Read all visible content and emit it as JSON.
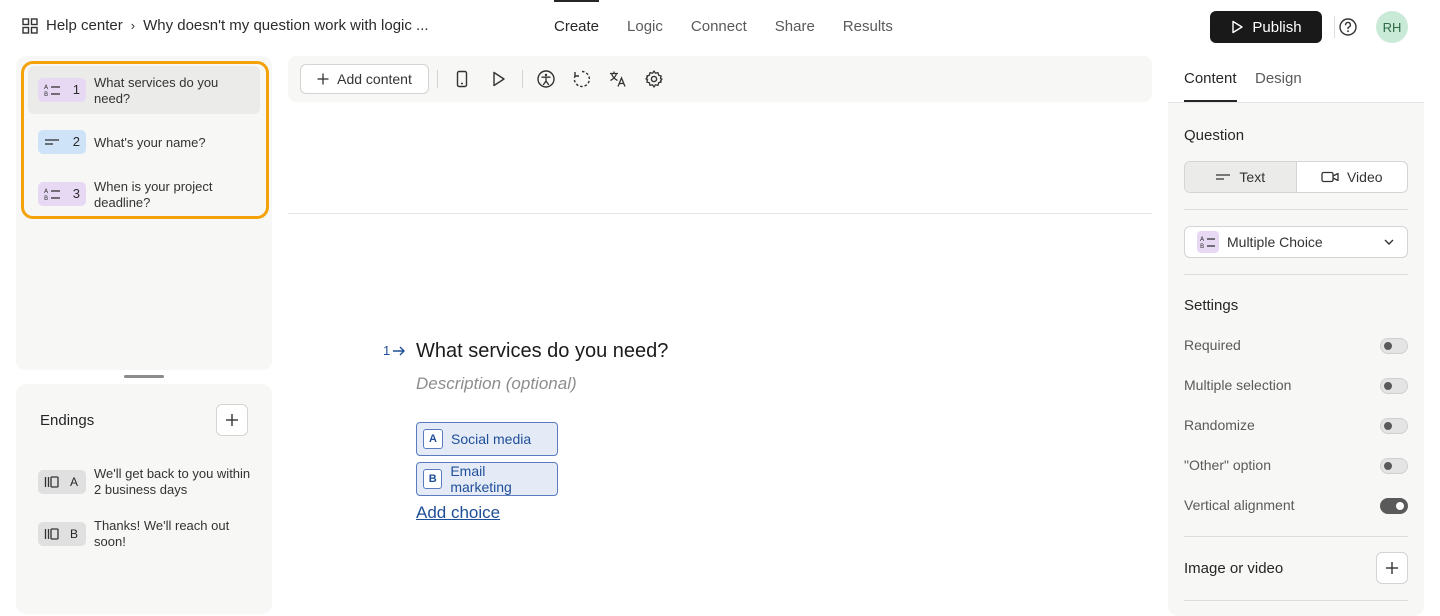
{
  "header": {
    "breadcrumb_root": "Help center",
    "breadcrumb_current": "Why doesn't my question work with logic ...",
    "tabs": [
      {
        "label": "Create",
        "active": true
      },
      {
        "label": "Logic",
        "active": false
      },
      {
        "label": "Connect",
        "active": false
      },
      {
        "label": "Share",
        "active": false
      },
      {
        "label": "Results",
        "active": false
      }
    ],
    "publish_label": "Publish",
    "avatar_initials": "RH"
  },
  "questions": [
    {
      "number": "1",
      "label": "What services do you need?",
      "type": "multiple-choice",
      "active": true
    },
    {
      "number": "2",
      "label": "What's your name?",
      "type": "short-text",
      "active": false
    },
    {
      "number": "3",
      "label": "When is your project deadline?",
      "type": "multiple-choice",
      "active": false
    }
  ],
  "endings": {
    "title": "Endings",
    "items": [
      {
        "letter": "A",
        "label": "We'll get back to you within 2 business days"
      },
      {
        "letter": "B",
        "label": "Thanks! We'll reach out soon!"
      }
    ]
  },
  "toolbar": {
    "add_content_label": "Add content"
  },
  "canvas": {
    "question_number": "1",
    "question_title": "What services do you need?",
    "description_placeholder": "Description (optional)",
    "choices": [
      {
        "key": "A",
        "label": "Social media"
      },
      {
        "key": "B",
        "label": "Email marketing"
      }
    ],
    "add_choice_label": "Add choice"
  },
  "right_panel": {
    "tabs": [
      {
        "label": "Content",
        "active": true
      },
      {
        "label": "Design",
        "active": false
      }
    ],
    "question_heading": "Question",
    "question_format": [
      {
        "label": "Text",
        "active": true
      },
      {
        "label": "Video",
        "active": false
      }
    ],
    "question_type": "Multiple Choice",
    "settings_heading": "Settings",
    "settings": [
      {
        "label": "Required",
        "on": false
      },
      {
        "label": "Multiple selection",
        "on": false
      },
      {
        "label": "Randomize",
        "on": false
      },
      {
        "label": "\"Other\" option",
        "on": false
      },
      {
        "label": "Vertical alignment",
        "on": true
      }
    ],
    "media_heading": "Image or video"
  },
  "colors": {
    "highlight": "#f5a10a",
    "multiple_choice_badge": "#e7d9f4",
    "short_text_badge": "#cfe3f8",
    "choice_accent": "#1f4e99",
    "publish_bg": "#191919"
  }
}
